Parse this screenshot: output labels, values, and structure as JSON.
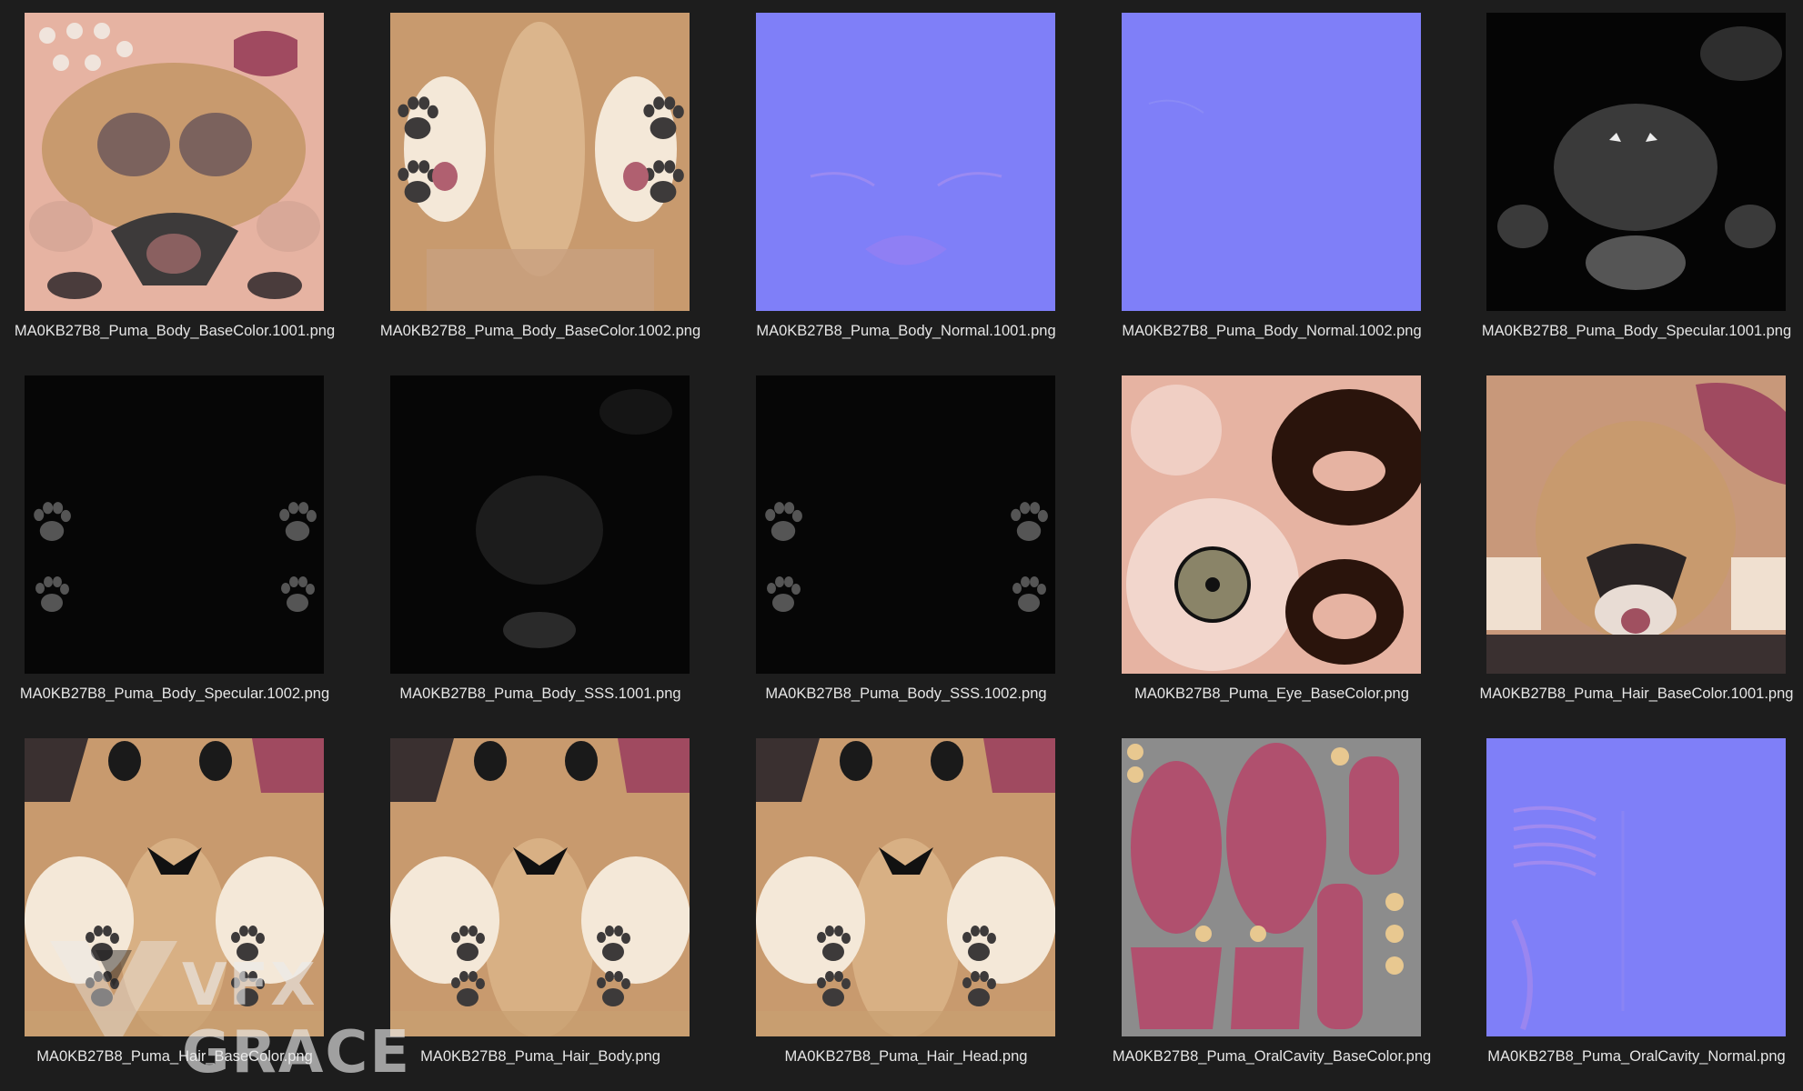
{
  "files": [
    {
      "name": "MA0KB27B8_Puma_Body_BaseColor.1001.png",
      "kind": "fur-face"
    },
    {
      "name": "MA0KB27B8_Puma_Body_BaseColor.1002.png",
      "kind": "fur-body"
    },
    {
      "name": "MA0KB27B8_Puma_Body_Normal.1001.png",
      "kind": "normal"
    },
    {
      "name": "MA0KB27B8_Puma_Body_Normal.1002.png",
      "kind": "normal-flat"
    },
    {
      "name": "MA0KB27B8_Puma_Body_Specular.1001.png",
      "kind": "specular-face"
    },
    {
      "name": "MA0KB27B8_Puma_Body_Specular.1002.png",
      "kind": "paws-black"
    },
    {
      "name": "MA0KB27B8_Puma_Body_SSS.1001.png",
      "kind": "sss-dark"
    },
    {
      "name": "MA0KB27B8_Puma_Body_SSS.1002.png",
      "kind": "paws-black"
    },
    {
      "name": "MA0KB27B8_Puma_Eye_BaseColor.png",
      "kind": "eye"
    },
    {
      "name": "MA0KB27B8_Puma_Hair_BaseColor.1001.png",
      "kind": "hair-face"
    },
    {
      "name": "MA0KB27B8_Puma_Hair_BaseColor.png",
      "kind": "hair-body"
    },
    {
      "name": "MA0KB27B8_Puma_Hair_Body.png",
      "kind": "hair-body"
    },
    {
      "name": "MA0KB27B8_Puma_Hair_Head.png",
      "kind": "hair-body"
    },
    {
      "name": "MA0KB27B8_Puma_OralCavity_BaseColor.png",
      "kind": "oral"
    },
    {
      "name": "MA0KB27B8_Puma_OralCavity_Normal.png",
      "kind": "normal-oral"
    }
  ],
  "watermark": {
    "text": "VFX GRACE"
  },
  "colors": {
    "background": "#1d1d1d",
    "label": "#e6e6e6",
    "normal_map": "#7f7ff8",
    "fur": "#c89a6e",
    "skin": "#e6b3a2",
    "oral_bg": "#8c8c8c",
    "oral_flesh": "#b0506e"
  }
}
